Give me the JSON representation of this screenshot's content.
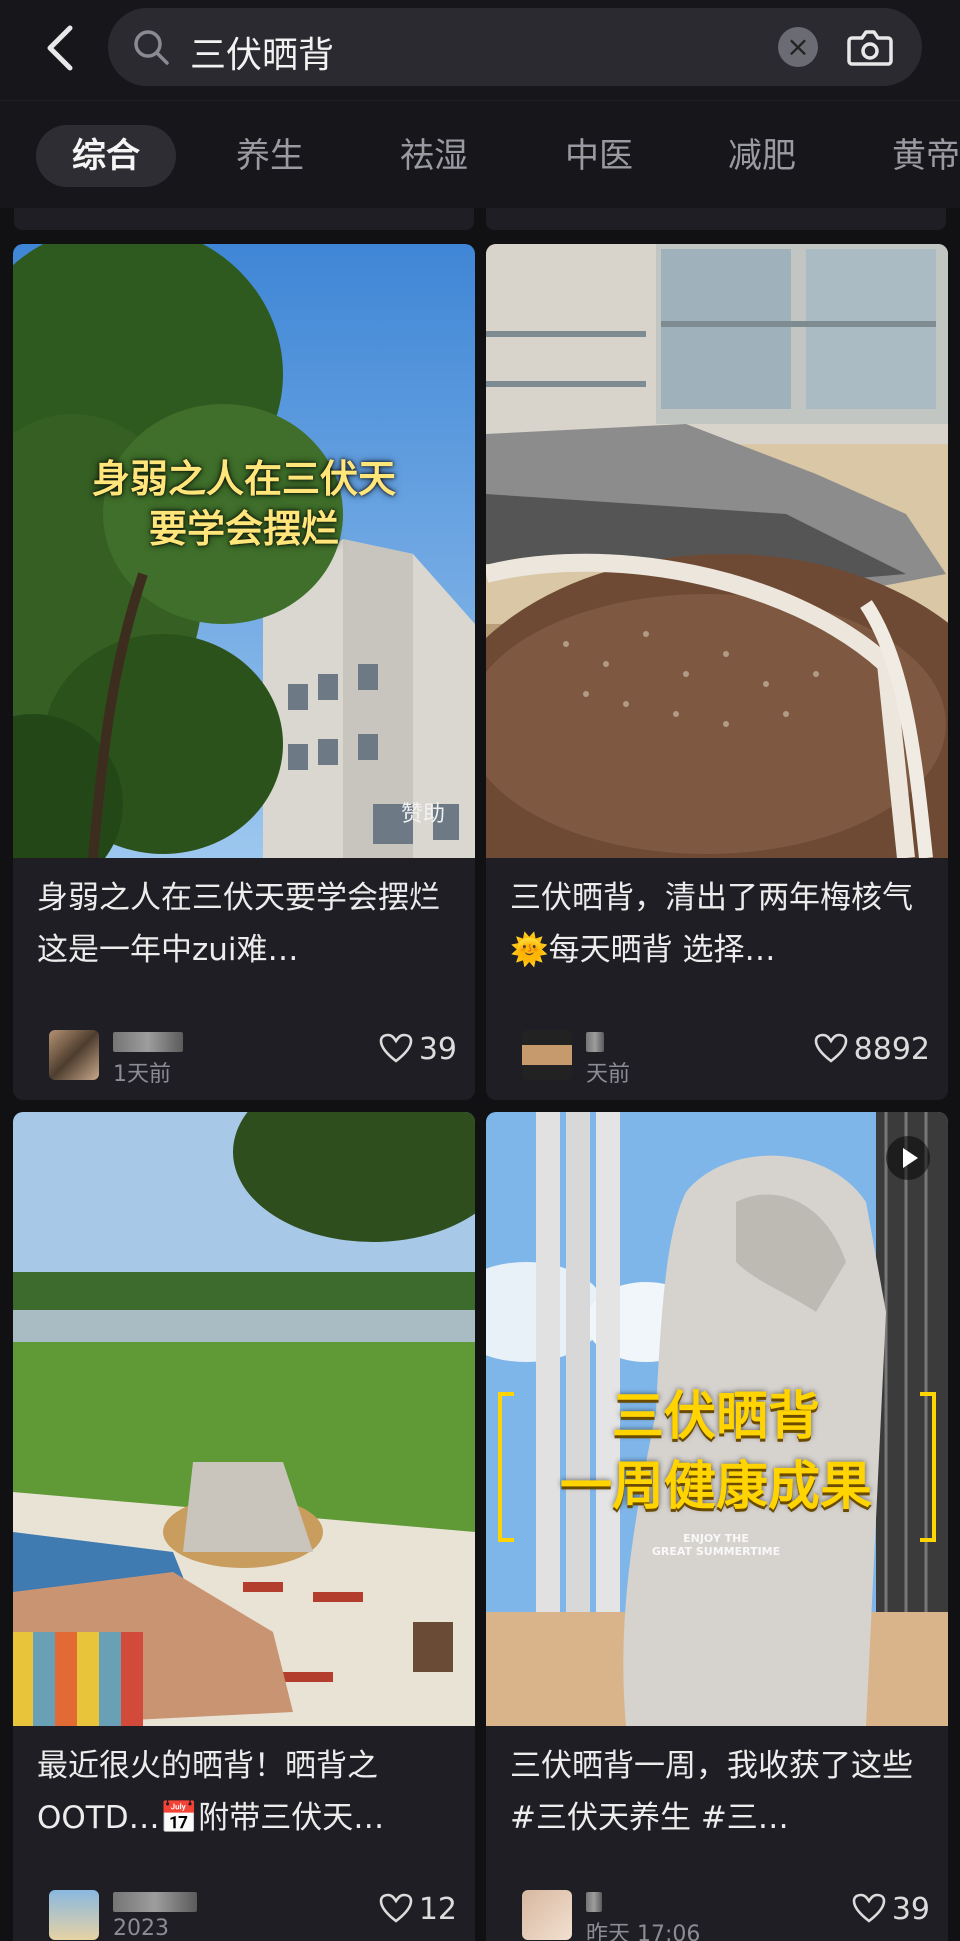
{
  "search": {
    "query": "三伏晒背"
  },
  "tabs": [
    {
      "label": "综合",
      "active": true
    },
    {
      "label": "养生"
    },
    {
      "label": "祛湿"
    },
    {
      "label": "中医"
    },
    {
      "label": "减肥"
    },
    {
      "label": "黄帝"
    }
  ],
  "cards": [
    {
      "overlay": "身弱之人在三伏天\n要学会摆烂",
      "sponsor": "赞助",
      "title": "身弱之人在三伏天要学会摆烂 这是一年中zui难…",
      "time": "1天前",
      "likes": "39"
    },
    {
      "title": "三伏晒背，清出了两年梅核气 🌞每天晒背 选择…",
      "time": "天前",
      "likes": "8892"
    },
    {
      "title": "最近很火的晒背！晒背之OOTD…📅附带三伏天…",
      "time": "2023",
      "likes": "12"
    },
    {
      "overlay": "三伏晒背\n一周健康成果",
      "overlay_small": "ENJOY THE\nGREAT SUMMERTIME",
      "title": "三伏晒背一周，我收获了这些 #三伏天养生 #三…",
      "time": "昨天 17:06",
      "likes": "39"
    }
  ],
  "colors": {
    "background": "#111114",
    "card": "#1e1e24",
    "active_tab": "#2d2d33"
  }
}
